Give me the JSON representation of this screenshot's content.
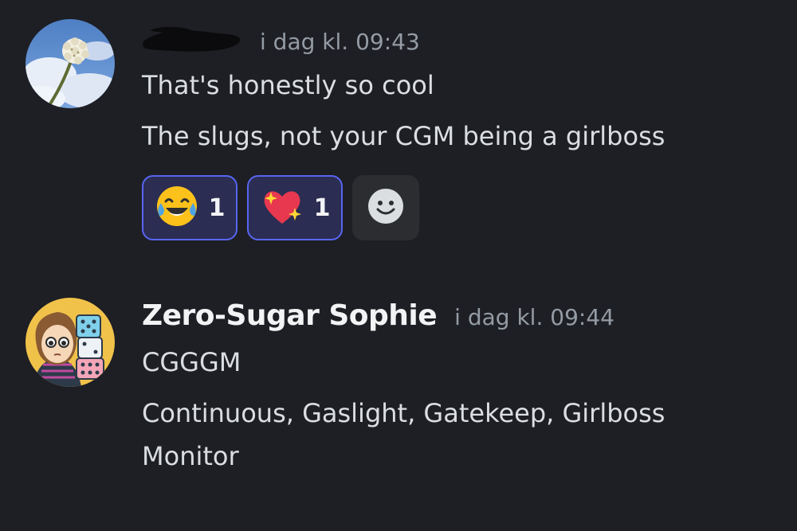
{
  "messages": [
    {
      "author": "",
      "author_redacted": true,
      "timestamp": "i dag kl. 09:43",
      "avatar_icon": "clover-flower-sky-avatar",
      "lines": [
        "That's honestly so cool",
        "The slugs, not your CGM being a girlboss"
      ],
      "reactions": [
        {
          "emoji": "joy-emoji",
          "count": "1"
        },
        {
          "emoji": "sparkling-heart-emoji",
          "count": "1"
        }
      ],
      "add_reaction_icon": "smiley-face-icon"
    },
    {
      "author": "Zero-Sugar Sophie",
      "timestamp": "i dag kl. 09:44",
      "avatar_icon": "cartoon-girl-with-dice-avatar",
      "lines": [
        "CGGGM",
        "Continuous, Gaslight, Gatekeep, Girlboss",
        "Monitor"
      ]
    }
  ],
  "colors": {
    "background": "#1e1f24",
    "username": "#f2f3f5",
    "timestamp": "#949ba4",
    "text": "#dbdee1",
    "reaction_border": "#5865f2",
    "reaction_bg": "#2b2d52",
    "add_reaction_bg": "#2b2d31"
  }
}
